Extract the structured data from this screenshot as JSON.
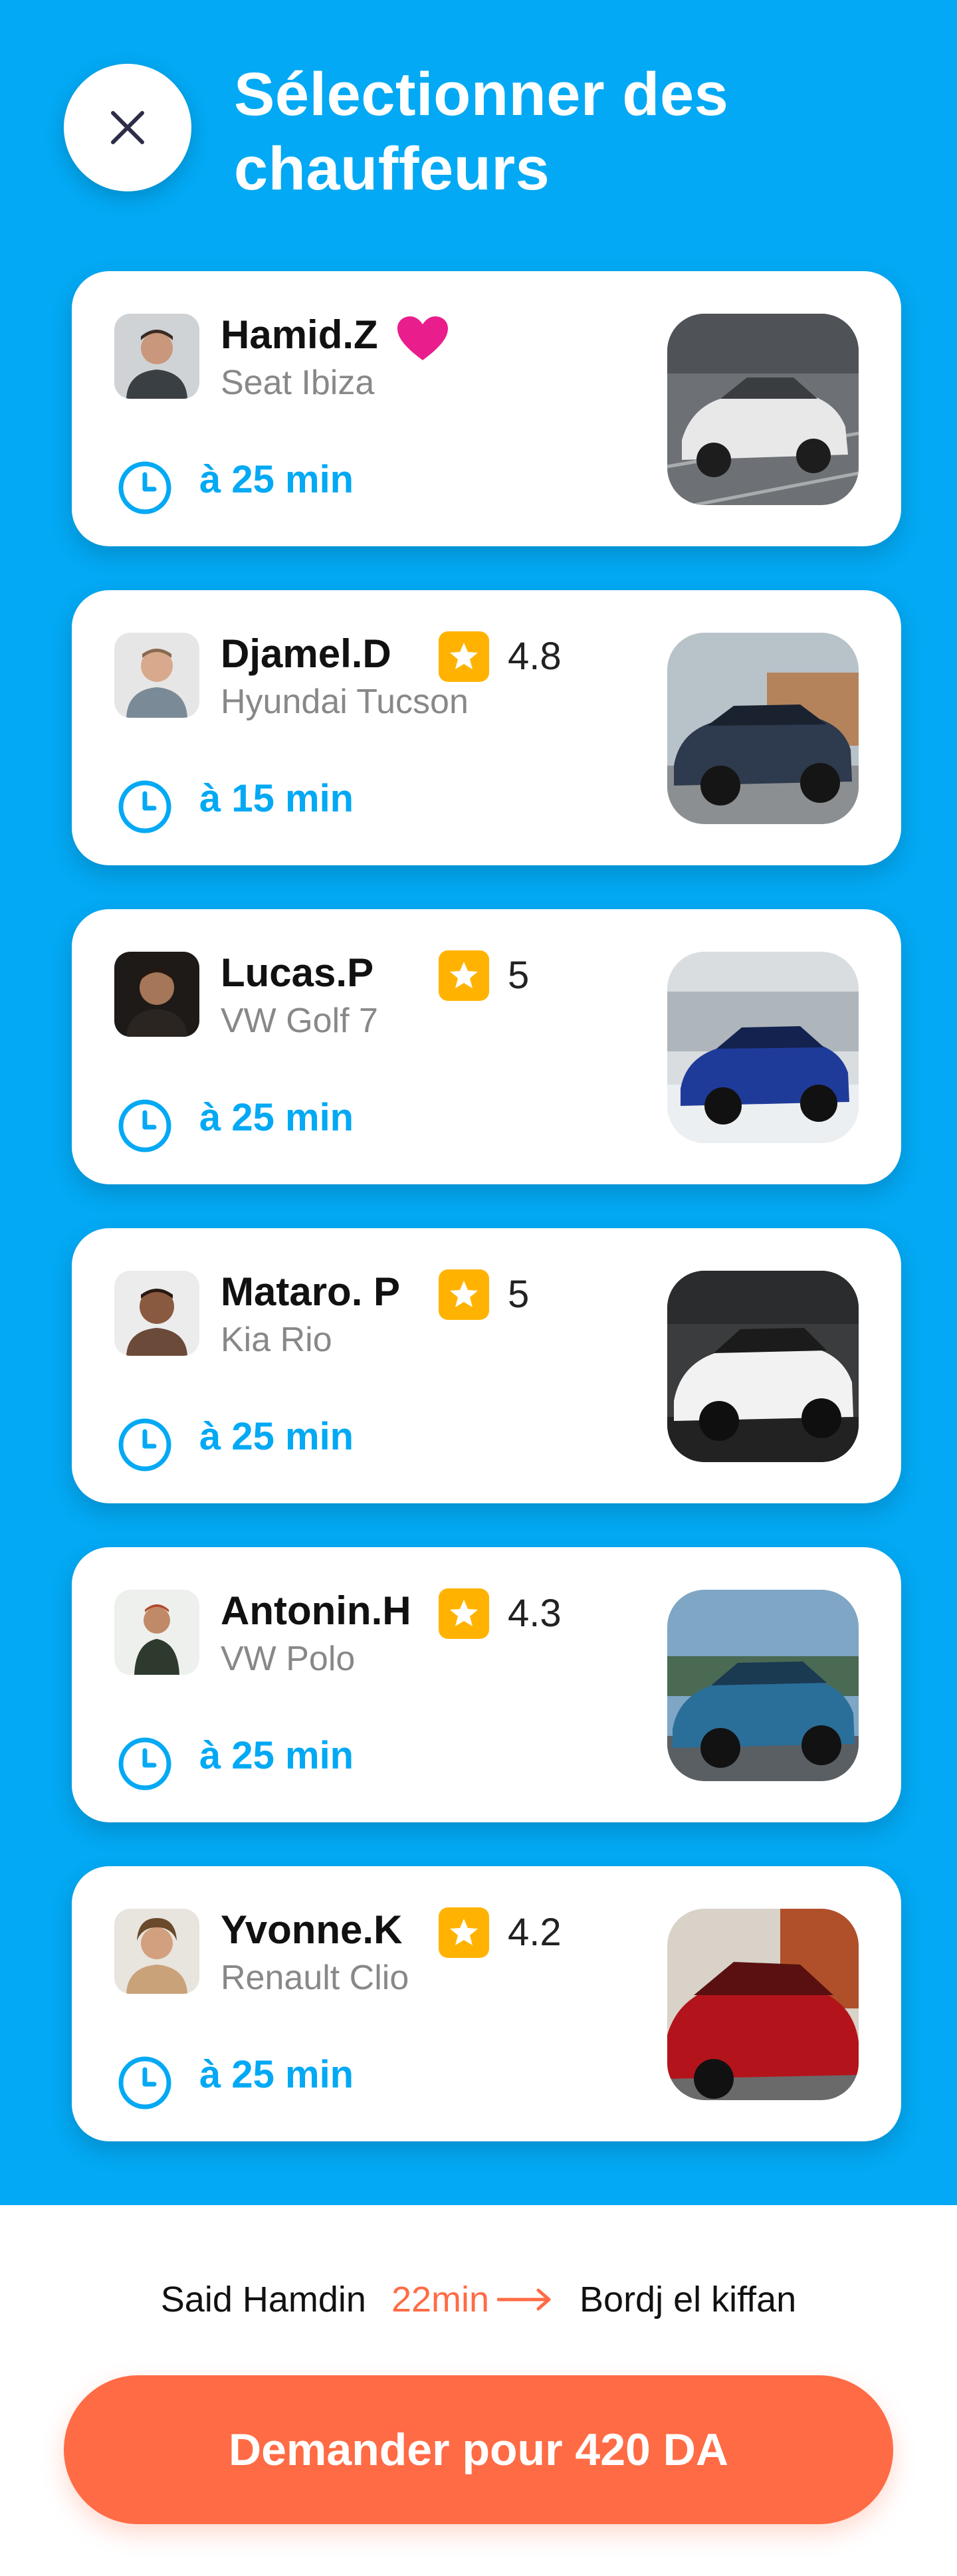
{
  "header": {
    "title": "Sélectionner des chauffeurs",
    "close_icon": "close-icon"
  },
  "drivers": [
    {
      "name": "Hamid.Z",
      "car": "Seat Ibiza",
      "favorite": true,
      "rating": "",
      "eta": "à 25 min",
      "photo_color": "#3a3f44",
      "car_color": "#e8e8e8"
    },
    {
      "name": "Djamel.D",
      "car": "Hyundai Tucson",
      "favorite": false,
      "rating": "4.8",
      "eta": "à 15 min",
      "photo_color": "#7a8a96",
      "car_color": "#2e3a4d"
    },
    {
      "name": "Lucas.P",
      "car": "VW Golf 7",
      "favorite": false,
      "rating": "5",
      "eta": "à 25 min",
      "photo_color": "#2b2522",
      "car_color": "#1f3b9a"
    },
    {
      "name": "Mataro. P",
      "car": "Kia Rio",
      "favorite": false,
      "rating": "5",
      "eta": "à 25 min",
      "photo_color": "#6b4a3a",
      "car_color": "#f2f2f2"
    },
    {
      "name": "Antonin.H",
      "car": "VW Polo",
      "favorite": false,
      "rating": "4.3",
      "eta": "à 25 min",
      "photo_color": "#5b6e55",
      "car_color": "#2a6f9a"
    },
    {
      "name": "Yvonne.K",
      "car": "Renault Clio",
      "favorite": false,
      "rating": "4.2",
      "eta": "à 25 min",
      "photo_color": "#c9a27a",
      "car_color": "#b3141b"
    }
  ],
  "route": {
    "origin": "Said Hamdin",
    "duration": "22min",
    "destination": "Bordj el kiffan"
  },
  "cta": {
    "label": "Demander pour 420 DA"
  },
  "colors": {
    "primary_blue": "#03A9F4",
    "accent_orange": "#FF6B45",
    "star_yellow": "#FFB300",
    "heart_pink": "#E91E8C"
  }
}
